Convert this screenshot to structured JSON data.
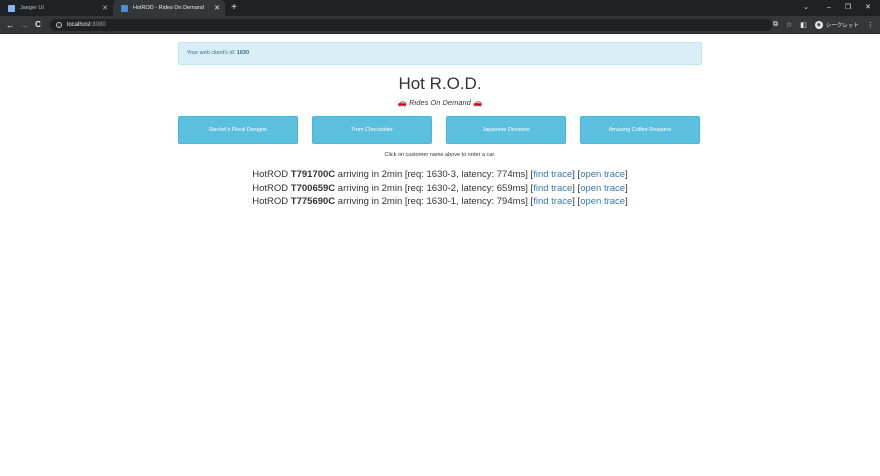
{
  "browser": {
    "tabs": [
      {
        "title": "Jaeger UI",
        "icon": "jaeger-favicon-icon",
        "active": false
      },
      {
        "title": "HotROD - Rides On Demand",
        "icon": "hotrod-favicon-icon",
        "active": true
      }
    ],
    "new_tab": "+",
    "window_controls": {
      "dropdown": "⌄",
      "minimize": "–",
      "restore": "❐",
      "close": "✕"
    },
    "nav": {
      "back": "←",
      "forward": "→",
      "reload": "C"
    },
    "url_host": "localhost",
    "url_port": ":8080",
    "info_icon": "i",
    "toolbar_icons": {
      "translate": "⧉",
      "bookmark": "☆",
      "sidepanel": "◧",
      "menu": "⋮"
    },
    "profile": {
      "avatar": "◉",
      "label": "シークレット"
    }
  },
  "page": {
    "alert_prefix": "Your web client's id: ",
    "client_id": "1630",
    "title": "Hot R.O.D.",
    "car_emoji": "🚗",
    "subtitle": "Rides On Demand",
    "customers": [
      "Rachel's Floral Designs",
      "Trom Chocolatier",
      "Japanese Desserts",
      "Amazing Coffee Roasters"
    ],
    "hint": "Click on customer name above to order a car.",
    "rides": [
      {
        "prefix": "HotROD ",
        "plate": "T791700C",
        "text": " arriving in 2min [req: 1630-3, latency: 774ms] [",
        "find": "find trace",
        "mid": "] [",
        "open": "open trace",
        "end": "]"
      },
      {
        "prefix": "HotROD ",
        "plate": "T700659C",
        "text": " arriving in 2min [req: 1630-2, latency: 659ms] [",
        "find": "find trace",
        "mid": "] [",
        "open": "open trace",
        "end": "]"
      },
      {
        "prefix": "HotROD ",
        "plate": "T775690C",
        "text": " arriving in 2min [req: 1630-1, latency: 794ms] [",
        "find": "find trace",
        "mid": "] [",
        "open": "open trace",
        "end": "]"
      }
    ]
  },
  "colors": {
    "alert_bg": "#d9edf7",
    "alert_text": "#31708f",
    "button_bg": "#5bc0de",
    "link": "#337ab7",
    "chrome_dark": "#202124",
    "chrome_toolbar": "#35363a"
  }
}
